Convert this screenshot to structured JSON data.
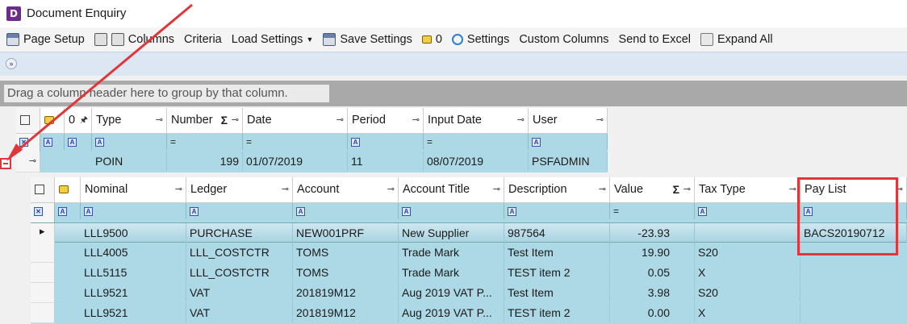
{
  "window": {
    "title": "Document Enquiry",
    "app_icon_letter": "D"
  },
  "toolbar": {
    "page_setup": "Page Setup",
    "columns": "Columns",
    "criteria": "Criteria",
    "load_settings": "Load Settings",
    "save_settings": "Save Settings",
    "zero": "0",
    "settings": "Settings",
    "custom_columns": "Custom Columns",
    "send_to_excel": "Send to Excel",
    "expand_all": "Expand All"
  },
  "group_hint": "Drag a column header here to group by that column.",
  "parent": {
    "headers": [
      "Type",
      "Number",
      "Date",
      "Period",
      "Input Date",
      "User"
    ],
    "filters": [
      "",
      "=",
      "=",
      "",
      "=",
      ""
    ],
    "row": {
      "type": "POIN",
      "number": "199",
      "date": "01/07/2019",
      "period": "11",
      "input_date": "08/07/2019",
      "user": "PSFADMIN"
    }
  },
  "child": {
    "headers": [
      "Nominal",
      "Ledger",
      "Account",
      "Account Title",
      "Description",
      "Value",
      "Tax Type",
      "Pay List"
    ],
    "filters": [
      "",
      "",
      "",
      "",
      "",
      "=",
      "",
      ""
    ],
    "rows": [
      {
        "nominal": "LLL9500",
        "ledger": "PURCHASE",
        "account": "NEW001PRF",
        "account_title": "New Supplier",
        "description": "987564",
        "value": "-23.93",
        "tax_type": "",
        "pay_list": "BACS20190712"
      },
      {
        "nominal": "LLL4005",
        "ledger": "LLL_COSTCTR",
        "account": "TOMS",
        "account_title": "Trade Mark",
        "description": "Test Item",
        "value": "19.90",
        "tax_type": "S20",
        "pay_list": ""
      },
      {
        "nominal": "LLL5115",
        "ledger": "LLL_COSTCTR",
        "account": "TOMS",
        "account_title": "Trade Mark",
        "description": "TEST item 2",
        "value": "0.05",
        "tax_type": "X",
        "pay_list": ""
      },
      {
        "nominal": "LLL9521",
        "ledger": "VAT",
        "account": "201819M12",
        "account_title": "Aug 2019 VAT P...",
        "description": "Test Item",
        "value": "3.98",
        "tax_type": "S20",
        "pay_list": ""
      },
      {
        "nominal": "LLL9521",
        "ledger": "VAT",
        "account": "201819M12",
        "account_title": "Aug 2019 VAT P...",
        "description": "TEST item 2",
        "value": "0.00",
        "tax_type": "X",
        "pay_list": ""
      }
    ]
  },
  "colors": {
    "grid_bg": "#add8e6",
    "highlight": "#e0363a"
  }
}
